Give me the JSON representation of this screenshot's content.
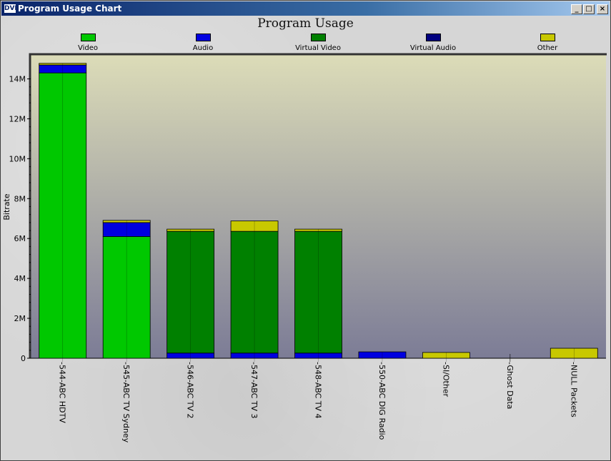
{
  "window": {
    "title": "Program Usage Chart",
    "icon_text": "DVB",
    "buttons": [
      "minimize",
      "maximize",
      "close"
    ]
  },
  "colors": {
    "Video": "#00c800",
    "Audio": "#0000e0",
    "Virtual Video": "#008000",
    "Virtual Audio": "#000080",
    "Other": "#c8c800",
    "plot_top": "#dcdcb8",
    "plot_bottom": "#7c7c96"
  },
  "chart_data": {
    "type": "bar",
    "stacked": true,
    "title": "Program Usage",
    "xlabel": "",
    "ylabel": "Bitrate",
    "ylim": [
      0,
      15200000
    ],
    "yticks": [
      0,
      2000000,
      4000000,
      6000000,
      8000000,
      10000000,
      12000000,
      14000000
    ],
    "ytick_labels": [
      "0",
      "2M",
      "4M",
      "6M",
      "8M",
      "10M",
      "12M",
      "14M"
    ],
    "legend_position": "top",
    "categories": [
      "-544-ABC HDTV",
      "-545-ABC TV Sydney",
      "-546-ABC TV 2",
      "-547-ABC TV 3",
      "-548-ABC TV 4",
      "-550-ABC DIG Radio",
      "-SI/Other",
      "-Ghost Data",
      "-NULL Packets"
    ],
    "series": [
      {
        "name": "Video",
        "values": [
          14300000,
          6100000,
          0,
          0,
          0,
          0,
          0,
          0,
          0
        ]
      },
      {
        "name": "Audio",
        "values": [
          400000,
          700000,
          260000,
          260000,
          260000,
          320000,
          0,
          0,
          0
        ]
      },
      {
        "name": "Virtual Video",
        "values": [
          0,
          0,
          6100000,
          6100000,
          6100000,
          0,
          0,
          0,
          0
        ]
      },
      {
        "name": "Virtual Audio",
        "values": [
          0,
          0,
          0,
          0,
          0,
          0,
          0,
          0,
          0
        ]
      },
      {
        "name": "Other",
        "values": [
          80000,
          110000,
          110000,
          520000,
          110000,
          0,
          290000,
          0,
          500000
        ]
      }
    ]
  }
}
